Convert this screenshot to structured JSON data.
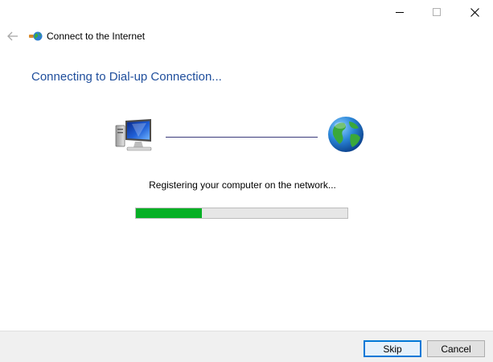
{
  "window": {
    "title": "Connect to the Internet",
    "controls": {
      "minimize": "minimize-icon",
      "maximize": "maximize-icon",
      "close": "close-icon"
    },
    "back_icon": "back-arrow-icon"
  },
  "main": {
    "heading": "Connecting to Dial-up Connection...",
    "status": "Registering your computer on the network...",
    "progress": 0.31,
    "icons": {
      "local": "computer-icon",
      "remote": "globe-icon"
    }
  },
  "footer": {
    "skip_label": "Skip",
    "cancel_label": "Cancel"
  },
  "colors": {
    "heading": "#1f4e9c",
    "progress_fill": "#06b025",
    "progress_track": "#e6e6e6",
    "footer_bg": "#f0f0f0",
    "accent_border": "#0078d7"
  }
}
